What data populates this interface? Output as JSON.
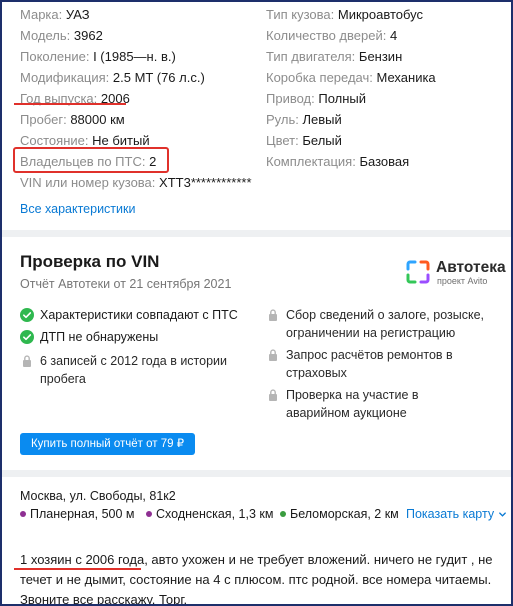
{
  "specs_left": [
    {
      "key": "Марка:",
      "value": "УАЗ"
    },
    {
      "key": "Модель:",
      "value": "3962"
    },
    {
      "key": "Поколение:",
      "value": "I (1985—н. в.)"
    },
    {
      "key": "Модификация:",
      "value": "2.5 MT (76 л.с.)"
    },
    {
      "key": "Год выпуска:",
      "value": "2006"
    },
    {
      "key": "Пробег:",
      "value": "88000 км"
    },
    {
      "key": "Состояние:",
      "value": "Не битый"
    },
    {
      "key": "Владельцев по ПТС:",
      "value": "2"
    },
    {
      "key": "VIN или номер кузова:",
      "value": "XTT3************"
    }
  ],
  "specs_right": [
    {
      "key": "Тип кузова:",
      "value": "Микроавтобус"
    },
    {
      "key": "Количество дверей:",
      "value": "4"
    },
    {
      "key": "Тип двигателя:",
      "value": "Бензин"
    },
    {
      "key": "Коробка передач:",
      "value": "Механика"
    },
    {
      "key": "Привод:",
      "value": "Полный"
    },
    {
      "key": "Руль:",
      "value": "Левый"
    },
    {
      "key": "Цвет:",
      "value": "Белый"
    },
    {
      "key": "Комплектация:",
      "value": "Базовая"
    }
  ],
  "all_specs_link": "Все характеристики",
  "vin_check": {
    "title": "Проверка по VIN",
    "subtitle": "Отчёт Автотеки от 21 сентября 2021",
    "logo_text": "Автотека",
    "logo_sub": "проект Avito",
    "left_items": [
      {
        "icon": "check-icon",
        "text": "Характеристики совпадают с ПТС"
      },
      {
        "icon": "check-icon",
        "text": "ДТП не обнаружены"
      },
      {
        "icon": "lock-icon",
        "text": "6 записей с 2012 года в истории пробега"
      }
    ],
    "right_items": [
      {
        "icon": "lock-icon",
        "text": "Сбор сведений о залоге, розыске, ограничении на регистрацию"
      },
      {
        "icon": "lock-icon",
        "text": "Запрос расчётов ремонтов в страховых"
      },
      {
        "icon": "lock-icon",
        "text": "Проверка на участие в аварийном аукционе"
      }
    ],
    "buy_button": "Купить полный отчёт от 79 ₽"
  },
  "location": {
    "address": "Москва, ул. Свободы, 81к2",
    "metro": [
      {
        "name": "Планерная, 500 м",
        "color": "#8e2f92"
      },
      {
        "name": "Сходненская, 1,3 км",
        "color": "#8e2f92"
      },
      {
        "name": "Беломорская, 2 км",
        "color": "#3a9c3f"
      }
    ],
    "map_link": "Показать карту"
  },
  "description": {
    "lead": "1 хозяин с 2006 года",
    "rest": ", авто ухожен и не требует вложений. ничего не гудит , не течет и не дымит, состояние на 4 с плюсом. птс родной. все номера читаемы. Звоните все расскажу. Торг."
  },
  "colors": {
    "accent": "#0a8bf0",
    "link": "#0a7ad4",
    "highlight": "#e0312b"
  }
}
